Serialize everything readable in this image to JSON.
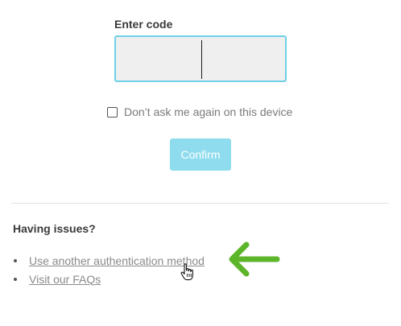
{
  "form": {
    "code_label": "Enter code",
    "code_value": "",
    "remember_label": "Don’t ask me again on this device",
    "remember_checked": false,
    "confirm_label": "Confirm"
  },
  "help": {
    "heading": "Having issues?",
    "links": [
      {
        "label": "Use another authentication method"
      },
      {
        "label": "Visit our FAQs"
      }
    ]
  },
  "annotations": {
    "arrow_icon": "left-arrow-icon",
    "arrow_color": "#5db52a",
    "cursor_icon": "hand-pointer-icon"
  },
  "colors": {
    "input_border": "#6fd0e6",
    "confirm_bg": "#8fdcee"
  }
}
